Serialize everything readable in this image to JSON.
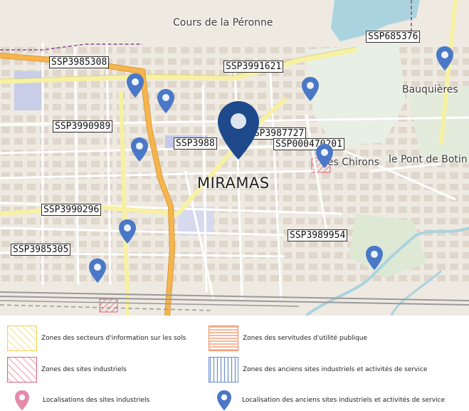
{
  "map": {
    "places": {
      "peronne": "Cours de la Péronne",
      "bauquieres": "Bauquières",
      "chirons": "les Chirons",
      "pont_botin": "le Pont de Botin",
      "city": "MIRAMAS"
    },
    "site_labels": [
      "SSP685376",
      "SSP3985308",
      "SSP3991621",
      "SSP3990989",
      "SSP3987727",
      "SSP3988",
      "SSP000470201",
      "SSP3990296",
      "SSP3989954",
      "SSP3985305"
    ],
    "colors": {
      "pin_blue": "#4a78c7",
      "pin_selected": "#1e4a8c",
      "pin_pink": "#e58aa7",
      "road_orange": "#f6b54c",
      "road_yellow": "#f7f1a1",
      "water": "#aad3df"
    }
  },
  "legend": {
    "info_sols": "Zones des secteurs d'information sur les sols",
    "servitudes": "Zones des servitudes d'utilité publique",
    "sites_industriels": "Zones des sites industriels",
    "anciens_sites": "Zones des anciens sites industriels et activités de service",
    "loc_sites": "Localisations des sites industriels",
    "loc_anciens": "Localisation des anciens sites industriels et activités de service"
  }
}
